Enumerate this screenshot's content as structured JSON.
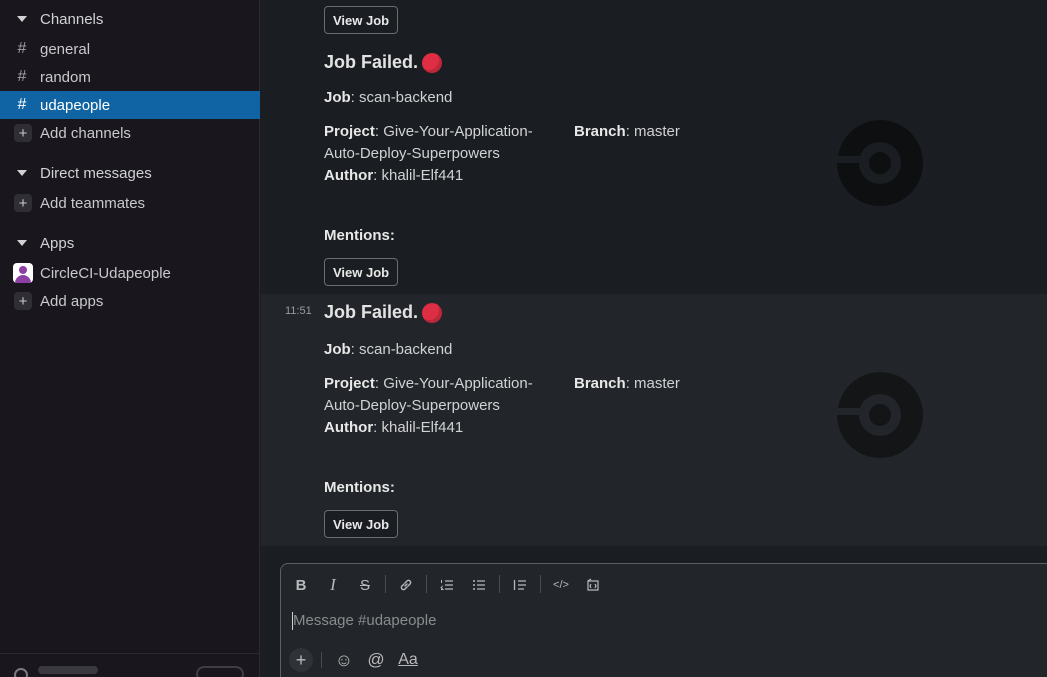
{
  "sidebar": {
    "channels_header": "Channels",
    "channels": [
      {
        "label": "general",
        "icon": "hash-icon",
        "active": false
      },
      {
        "label": "random",
        "icon": "hash-icon",
        "active": false
      },
      {
        "label": "udapeople",
        "icon": "hash-icon",
        "active": true
      }
    ],
    "add_channels": "Add channels",
    "dm_header": "Direct messages",
    "add_teammates": "Add teammates",
    "apps_header": "Apps",
    "app_name": "CircleCI-Udapeople",
    "add_apps": "Add apps",
    "hash_glyph": "#",
    "plus_glyph": "+"
  },
  "messages": {
    "top_button": "View Job",
    "cards": [
      {
        "timestamp": "",
        "title": "Job Failed.",
        "job_label": "Job",
        "job_value": ": scan-backend",
        "project_label": "Project",
        "project_value_1": ": Give-Your-Application-",
        "project_value_2": "Auto-Deploy-Superpowers",
        "branch_label": "Branch",
        "branch_value": ": master",
        "author_label": "Author",
        "author_value": ": khalil-Elf441",
        "mentions_label": "Mentions",
        "mentions_value": ":",
        "button": "View Job"
      },
      {
        "timestamp": "11:51",
        "title": "Job Failed.",
        "job_label": "Job",
        "job_value": ": scan-backend",
        "project_label": "Project",
        "project_value_1": ": Give-Your-Application-",
        "project_value_2": "Auto-Deploy-Superpowers",
        "branch_label": "Branch",
        "branch_value": ": master",
        "author_label": "Author",
        "author_value": ": khalil-Elf441",
        "mentions_label": "Mentions",
        "mentions_value": ":",
        "button": "View Job"
      }
    ]
  },
  "composer": {
    "placeholder": "Message #udapeople",
    "toolbar": {
      "bold": "B",
      "italic": "I",
      "strike": "S",
      "code": "</>"
    },
    "format_label": "Aa",
    "mention_glyph": "@",
    "emoji_glyph": "☺",
    "plus_glyph": "+"
  },
  "colors": {
    "sidebar_bg": "#19171d",
    "active_channel": "#1164a3",
    "status_red": "#dd2e44",
    "main_bg": "#1a1d21"
  }
}
